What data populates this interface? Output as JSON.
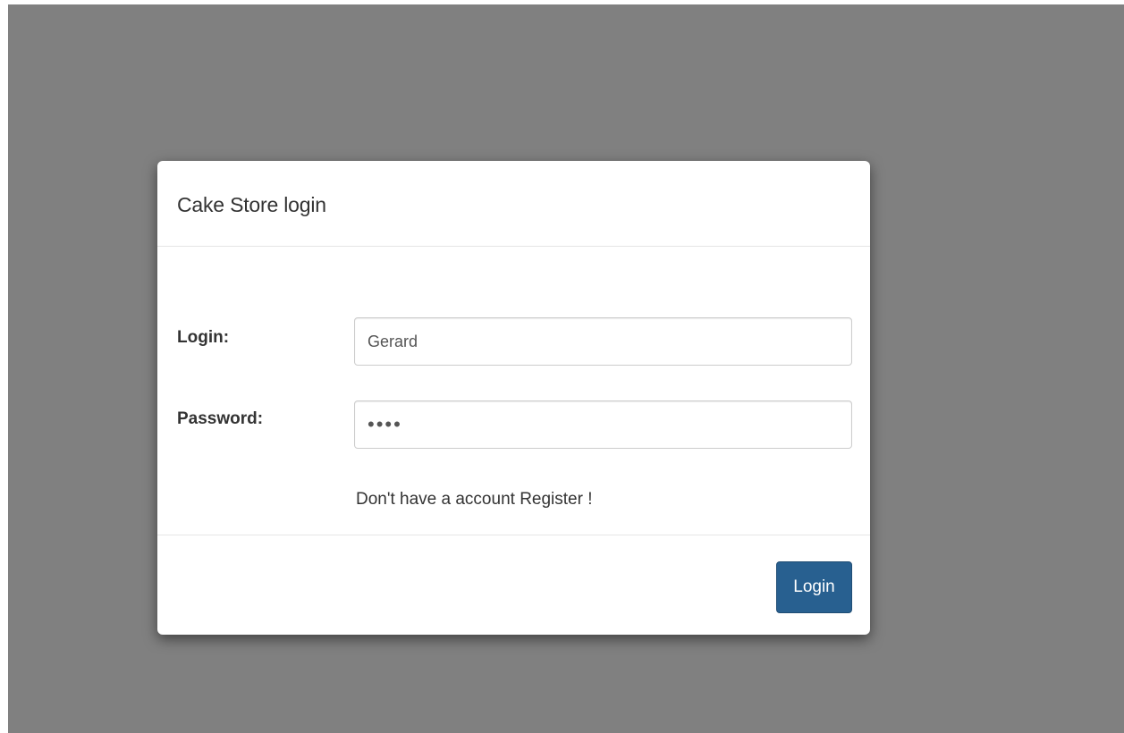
{
  "modal": {
    "title": "Cake Store login"
  },
  "form": {
    "login_label": "Login:",
    "login_value": "Gerard",
    "password_label": "Password:",
    "password_value": "****",
    "register_text": "Don't have a account Register !"
  },
  "footer": {
    "login_button_label": "Login"
  },
  "colors": {
    "backdrop": "#808080",
    "primary_button": "#286090"
  }
}
